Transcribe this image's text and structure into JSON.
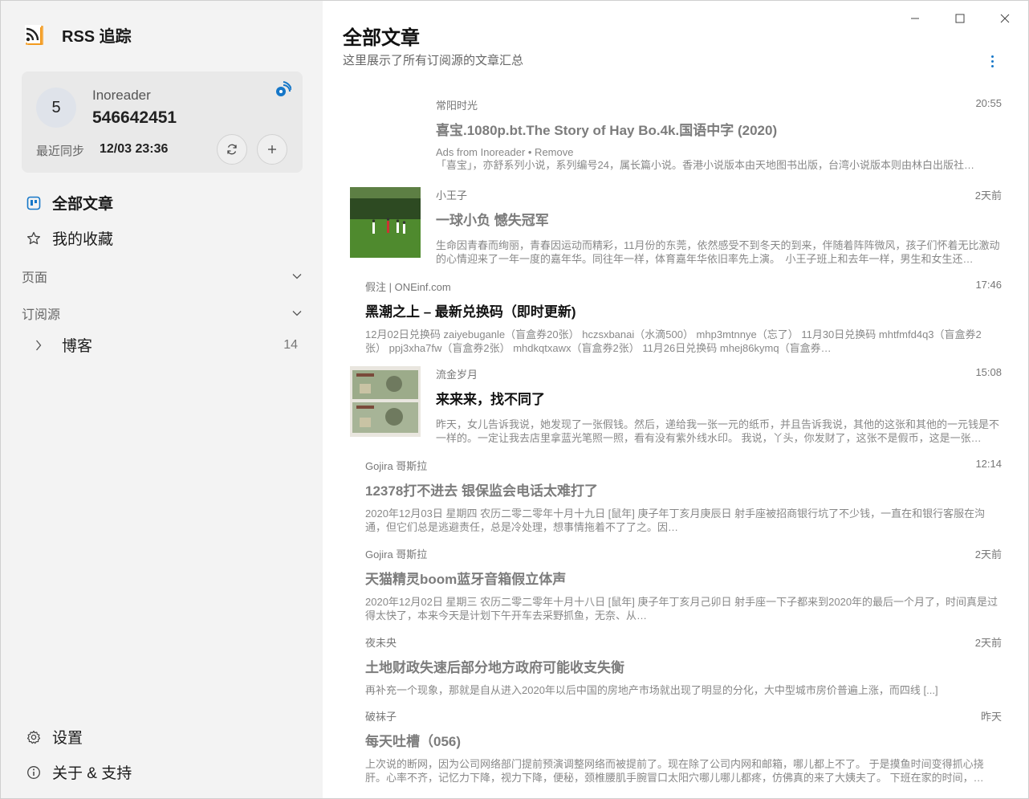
{
  "app": {
    "title": "RSS 追踪"
  },
  "account": {
    "avatar_text": "5",
    "service": "Inoreader",
    "id": "546642451",
    "sync_label": "最近同步",
    "sync_time": "12/03 23:36"
  },
  "nav": {
    "all_articles": "全部文章",
    "favorites": "我的收藏",
    "pages_section": "页面",
    "feeds_section": "订阅源",
    "folder_label": "博客",
    "folder_count": "14",
    "settings": "设置",
    "about": "关于 & 支持"
  },
  "main": {
    "title": "全部文章",
    "subtitle": "这里展示了所有订阅源的文章汇总"
  },
  "articles": [
    {
      "source": "常阳时光",
      "time": "20:55",
      "title": "喜宝.1080p.bt.The Story of Hay Bo.4k.国语中字 (2020)",
      "sub": "Ads from Inoreader • Remove",
      "summary": "「喜宝」，亦舒系列小说，系列编号24，属长篇小说。香港小说版本由天地图书出版，台湾小说版本则由林白出版社…"
    },
    {
      "source": "小王子",
      "time": "2天前",
      "title": "一球小负 憾失冠军",
      "summary": "生命因青春而绚丽，青春因运动而精彩，11月份的东莞，依然感受不到冬天的到来，伴随着阵阵微风，孩子们怀着无比激动的心情迎来了一年一度的嘉年华。同往年一样，体育嘉年华依旧率先上演。　小王子班上和去年一样，男生和女生还…"
    },
    {
      "source": "假注 | ONEinf.com",
      "time": "17:46",
      "title": "黑潮之上 – 最新兑换码（即时更新)",
      "summary": "12月02日兑换码 zaiyebuganle（盲盒券20张） hczsxbanai（水滴500） mhp3mtnnye（忘了） 11月30日兑换码 mhtfmfd4q3（盲盒券2张） ppj3xha7fw（盲盒券2张） mhdkqtxawx（盲盒券2张） 11月26日兑换码 mhej86kymq（盲盒券…"
    },
    {
      "source": "流金岁月",
      "time": "15:08",
      "title": "来来来，找不同了",
      "summary": "昨天，女儿告诉我说，她发现了一张假钱。然后，递给我一张一元的纸币，并且告诉我说，其他的这张和其他的一元钱是不一样的。一定让我去店里拿蓝光笔照一照，看有没有紫外线水印。 我说，丫头，你发财了，这张不是假币，这是一张…"
    },
    {
      "source": "Gojira 哥斯拉",
      "time": "12:14",
      "title": "12378打不进去 银保监会电话太难打了",
      "summary": "2020年12月03日 星期四 农历二零二零年十月十九日 [鼠年] 庚子年丁亥月庚辰日 射手座被招商银行坑了不少钱，一直在和银行客服在沟通，但它们总是逃避责任，总是冷处理，想事情拖着不了了之。因…"
    },
    {
      "source": "Gojira 哥斯拉",
      "time": "2天前",
      "title": "天猫精灵boom蓝牙音箱假立体声",
      "summary": "2020年12月02日 星期三 农历二零二零年十月十八日 [鼠年] 庚子年丁亥月己卯日 射手座一下子都来到2020年的最后一个月了，时间真是过得太快了，本来今天是计划下午开车去采野抓鱼，无奈、从…"
    },
    {
      "source": "夜未央",
      "time": "2天前",
      "title": "土地财政失速后部分地方政府可能收支失衡",
      "summary": "再补充一个现象，那就是自从进入2020年以后中国的房地产市场就出现了明显的分化，大中型城市房价普遍上涨，而四线 [...]"
    },
    {
      "source": "破袜子",
      "time": "昨天",
      "title": "每天吐槽（056)",
      "summary": "上次说的断网，因为公司网络部门提前预演调整网络而被提前了。现在除了公司内网和邮箱，哪儿都上不了。 于是摸鱼时间变得抓心挠肝。心率不齐，记忆力下降，视力下降，便秘，颈椎腰肌手腕冒口太阳穴哪儿哪儿都疼，仿佛真的来了大姨夫了。 下班在家的时间，…"
    }
  ],
  "colors": {
    "accent": "#1677c8",
    "rss_orange": "#f39a1e",
    "sidebar_bg": "#f3f3f3",
    "card_bg": "#e9e9e9"
  }
}
